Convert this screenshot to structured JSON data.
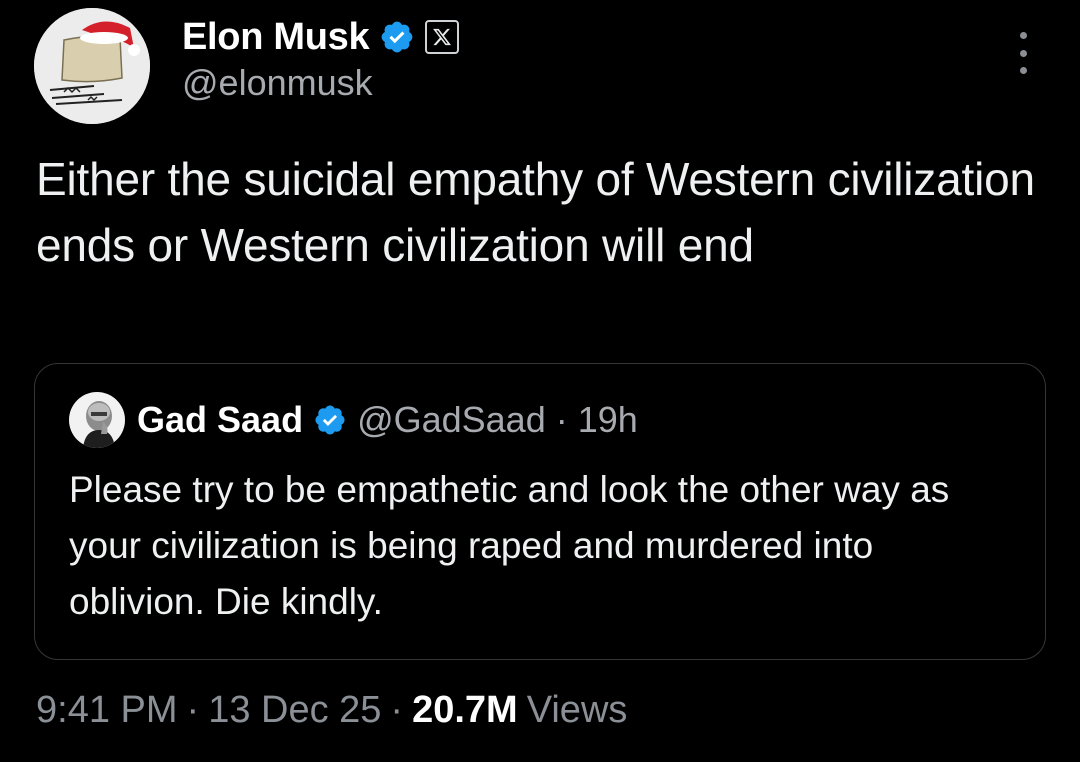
{
  "author": {
    "display_name": "Elon Musk",
    "handle": "@elonmusk",
    "verified_icon": "verified-badge-icon",
    "affiliation_icon": "x-logo-icon",
    "avatar_caption": "x-logo-icon"
  },
  "tweet": {
    "text": "Either the suicidal empathy of Western civilization ends or Western civilization will end"
  },
  "quoted": {
    "display_name": "Gad Saad",
    "handle": "@GadSaad",
    "separator": "·",
    "time": "19h",
    "text": "Please try to be empathetic and look the other way as your civilization is being raped and murdered into oblivion. Die kindly."
  },
  "meta": {
    "time": "9:41 PM",
    "sep1": "·",
    "date": "13 Dec 25",
    "sep2": "·",
    "views_count": "20.7M",
    "views_label": "Views"
  },
  "colors": {
    "background": "#000000",
    "text": "#e7e9ea",
    "muted": "#8b9096",
    "verified": "#1d9bf0",
    "border": "#333639"
  }
}
